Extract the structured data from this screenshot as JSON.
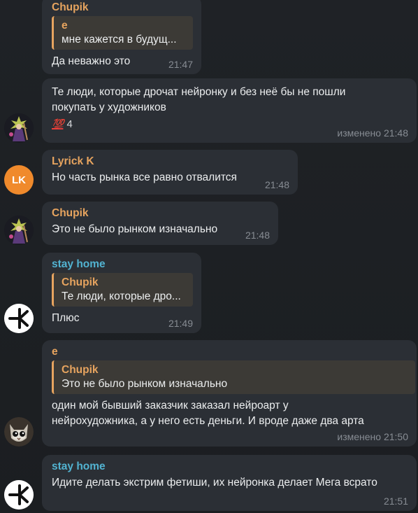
{
  "messages": [
    {
      "sender": "Chupik",
      "reply": {
        "name": "е",
        "text": "мне кажется в будущ..."
      },
      "text": "Да неважно это",
      "time": "21:47"
    },
    {
      "text_line1": "Те люди, которые дрочат нейронку и без неё бы не пошли",
      "text_line2": "покупать у художников",
      "reaction": {
        "emoji": "💯",
        "count": "4"
      },
      "time": "изменено 21:48"
    },
    {
      "sender": "Lyrick K",
      "avatar_initials": "LK",
      "text": "Но часть рынка все равно отвалится",
      "time": "21:48"
    },
    {
      "sender": "Chupik",
      "text": "Это не было рынком изначально",
      "time": "21:48"
    },
    {
      "sender": "stay home",
      "reply": {
        "name": "Chupik",
        "text": "Те люди, которые дро..."
      },
      "text": "Плюс",
      "time": "21:49"
    },
    {
      "sender": "е",
      "reply": {
        "name": "Chupik",
        "text": "Это не было рынком изначально"
      },
      "text_line1": "один мой бывший заказчик заказал нейроарт у",
      "text_line2": "нейрохудожника, а у него есть деньги. И вроде даже два арта",
      "time": "изменено 21:50"
    },
    {
      "sender": "stay home",
      "text": "Идите делать экстрим фетиши, их нейронка делает Мега всрато",
      "time": "21:51"
    }
  ],
  "colors": {
    "background": "#1d2024",
    "bubble": "#2b2f35",
    "name_orange": "#e7a45f",
    "name_teal": "#52b3d1",
    "time_gray": "#878c93",
    "lk_avatar": "#f08a2c"
  },
  "icons": {
    "chupik_avatar": "wizard-avatar-icon",
    "stay_home_avatar": "arrow-logo-avatar-icon",
    "e_avatar": "cat-avatar-icon"
  }
}
